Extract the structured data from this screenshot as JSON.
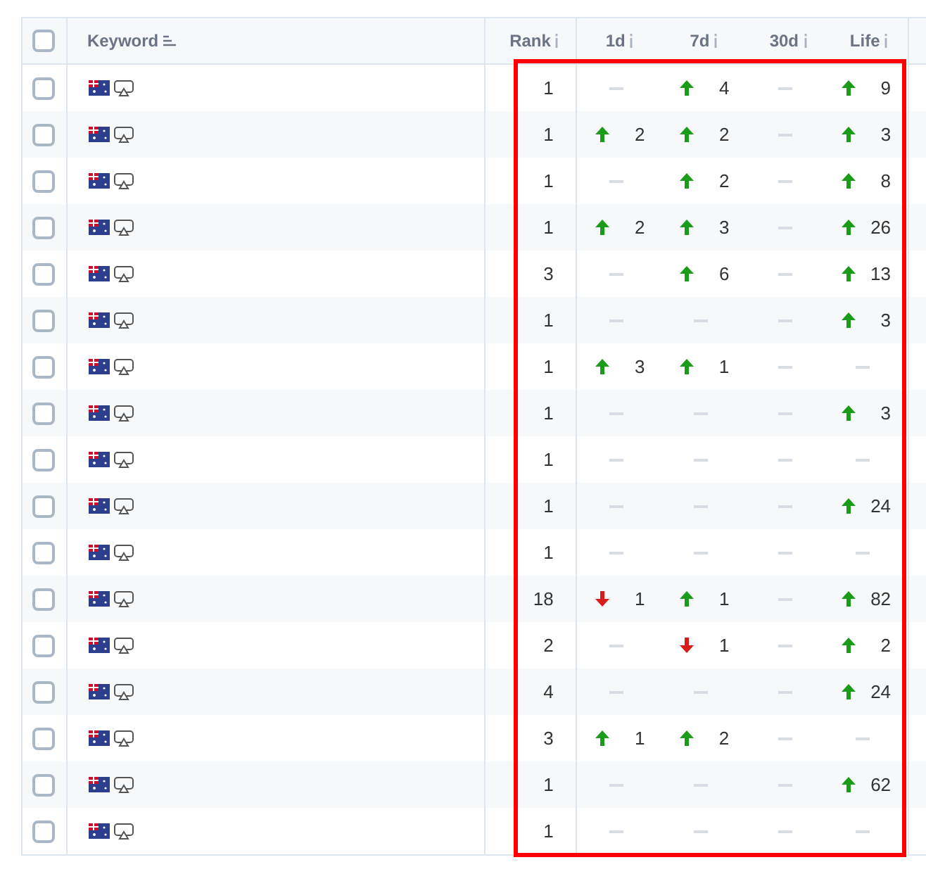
{
  "select_all": {
    "checked": false
  },
  "columns": [
    {
      "label": "Keyword",
      "kind": "sort"
    },
    {
      "label": "Rank",
      "kind": "info"
    },
    {
      "label": "1d",
      "kind": "info"
    },
    {
      "label": "7d",
      "kind": "info"
    },
    {
      "label": "30d",
      "kind": "info"
    },
    {
      "label": "Life",
      "kind": "info"
    }
  ],
  "rows": [
    {
      "checked": false,
      "rank": "1",
      "changes": [
        {
          "changed": false
        },
        {
          "changed": true,
          "rising": true,
          "value": "4"
        },
        {
          "changed": false
        },
        {
          "changed": true,
          "rising": true,
          "value": "9"
        }
      ]
    },
    {
      "checked": false,
      "rank": "1",
      "changes": [
        {
          "changed": true,
          "rising": true,
          "value": "2"
        },
        {
          "changed": true,
          "rising": true,
          "value": "2"
        },
        {
          "changed": false
        },
        {
          "changed": true,
          "rising": true,
          "value": "3"
        }
      ]
    },
    {
      "checked": false,
      "rank": "1",
      "changes": [
        {
          "changed": false
        },
        {
          "changed": true,
          "rising": true,
          "value": "2"
        },
        {
          "changed": false
        },
        {
          "changed": true,
          "rising": true,
          "value": "8"
        }
      ]
    },
    {
      "checked": false,
      "rank": "1",
      "changes": [
        {
          "changed": true,
          "rising": true,
          "value": "2"
        },
        {
          "changed": true,
          "rising": true,
          "value": "3"
        },
        {
          "changed": false
        },
        {
          "changed": true,
          "rising": true,
          "value": "26"
        }
      ]
    },
    {
      "checked": false,
      "rank": "3",
      "changes": [
        {
          "changed": false
        },
        {
          "changed": true,
          "rising": true,
          "value": "6"
        },
        {
          "changed": false
        },
        {
          "changed": true,
          "rising": true,
          "value": "13"
        }
      ]
    },
    {
      "checked": false,
      "rank": "1",
      "changes": [
        {
          "changed": false
        },
        {
          "changed": false
        },
        {
          "changed": false
        },
        {
          "changed": true,
          "rising": true,
          "value": "3"
        }
      ]
    },
    {
      "checked": false,
      "rank": "1",
      "changes": [
        {
          "changed": true,
          "rising": true,
          "value": "3"
        },
        {
          "changed": true,
          "rising": true,
          "value": "1"
        },
        {
          "changed": false
        },
        {
          "changed": false
        }
      ]
    },
    {
      "checked": false,
      "rank": "1",
      "changes": [
        {
          "changed": false
        },
        {
          "changed": false
        },
        {
          "changed": false
        },
        {
          "changed": true,
          "rising": true,
          "value": "3"
        }
      ]
    },
    {
      "checked": false,
      "rank": "1",
      "changes": [
        {
          "changed": false
        },
        {
          "changed": false
        },
        {
          "changed": false
        },
        {
          "changed": false
        }
      ]
    },
    {
      "checked": false,
      "rank": "1",
      "changes": [
        {
          "changed": false
        },
        {
          "changed": false
        },
        {
          "changed": false
        },
        {
          "changed": true,
          "rising": true,
          "value": "24"
        }
      ]
    },
    {
      "checked": false,
      "rank": "1",
      "changes": [
        {
          "changed": false
        },
        {
          "changed": false
        },
        {
          "changed": false
        },
        {
          "changed": false
        }
      ]
    },
    {
      "checked": false,
      "rank": "18",
      "changes": [
        {
          "changed": true,
          "rising": false,
          "value": "1"
        },
        {
          "changed": true,
          "rising": true,
          "value": "1"
        },
        {
          "changed": false
        },
        {
          "changed": true,
          "rising": true,
          "value": "82"
        }
      ]
    },
    {
      "checked": false,
      "rank": "2",
      "changes": [
        {
          "changed": false
        },
        {
          "changed": true,
          "rising": false,
          "value": "1"
        },
        {
          "changed": false
        },
        {
          "changed": true,
          "rising": true,
          "value": "2"
        }
      ]
    },
    {
      "checked": false,
      "rank": "4",
      "changes": [
        {
          "changed": false
        },
        {
          "changed": false
        },
        {
          "changed": false
        },
        {
          "changed": true,
          "rising": true,
          "value": "24"
        }
      ]
    },
    {
      "checked": false,
      "rank": "3",
      "changes": [
        {
          "changed": true,
          "rising": true,
          "value": "1"
        },
        {
          "changed": true,
          "rising": true,
          "value": "2"
        },
        {
          "changed": false
        },
        {
          "changed": false
        }
      ]
    },
    {
      "checked": false,
      "rank": "1",
      "changes": [
        {
          "changed": false
        },
        {
          "changed": false
        },
        {
          "changed": false
        },
        {
          "changed": true,
          "rising": true,
          "value": "62"
        }
      ]
    },
    {
      "checked": false,
      "rank": "1",
      "changes": [
        {
          "changed": false
        },
        {
          "changed": false
        },
        {
          "changed": false
        },
        {
          "changed": false
        }
      ]
    }
  ]
}
